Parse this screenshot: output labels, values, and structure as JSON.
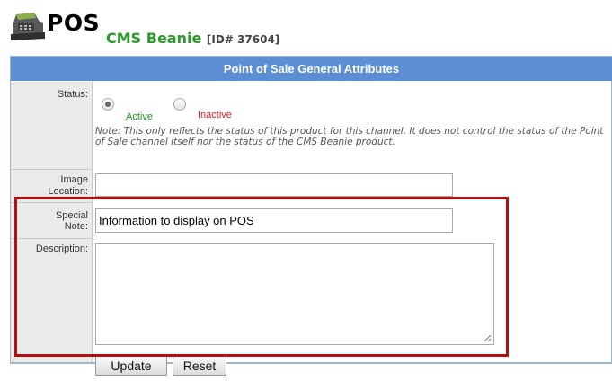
{
  "header": {
    "logo_icon": "cash-register-icon",
    "pos_label": "POS",
    "product_name": "CMS Beanie",
    "product_id": "[ID# 37604]"
  },
  "section": {
    "title": "Point of Sale General Attributes"
  },
  "fields": {
    "status": {
      "label": "Status:",
      "options": [
        {
          "label": "Active",
          "selected": true
        },
        {
          "label": "Inactive",
          "selected": false
        }
      ],
      "note": "Note: This only reflects the status of this product for this channel. It does not control the status of the Point of Sale channel itself nor the status of the CMS Beanie product."
    },
    "image_location": {
      "label_line1": "Image",
      "label_line2": "Location:",
      "value": ""
    },
    "special_note": {
      "label_line1": "Special",
      "label_line2": "Note:",
      "value": "Information to display on POS"
    },
    "description": {
      "label": "Description:",
      "value": ""
    }
  },
  "buttons": {
    "update": "Update",
    "reset": "Reset"
  },
  "colors": {
    "section_header": "#5b8ed3",
    "product_name": "#2a9a2a",
    "active": "#1d9a1d",
    "inactive": "#e41b1b",
    "highlight": "#b50e0e"
  }
}
